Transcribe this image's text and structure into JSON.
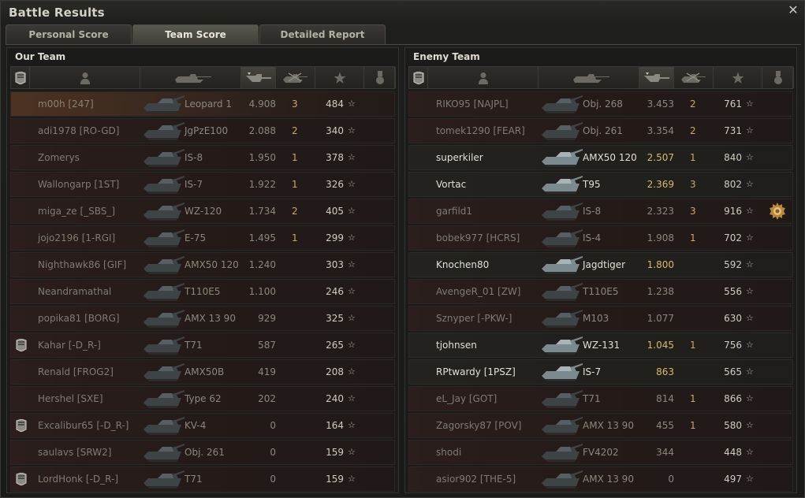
{
  "window": {
    "title": "Battle Results"
  },
  "tabs": [
    {
      "label": "Personal Score",
      "active": false
    },
    {
      "label": "Team Score",
      "active": true
    },
    {
      "label": "Detailed Report",
      "active": false
    }
  ],
  "columns": [
    "badge-icon",
    "player-icon",
    "vehicle-icon",
    "damage-icon",
    "kills-icon",
    "xp-star-icon",
    "medal-icon"
  ],
  "our_team": {
    "title": "Our Team",
    "players": [
      {
        "name": "m00h [247]",
        "vehicle": "Leopard 1",
        "damage": "4.908",
        "kills": "3",
        "xp": "484",
        "badge": false,
        "alive": false,
        "me": true
      },
      {
        "name": "adi1978 [RO-GD]",
        "vehicle": "JgPzE100",
        "damage": "2.088",
        "kills": "2",
        "xp": "340",
        "badge": false,
        "alive": false
      },
      {
        "name": "Zomerys",
        "vehicle": "IS-8",
        "damage": "1.950",
        "kills": "1",
        "xp": "378",
        "badge": false,
        "alive": false
      },
      {
        "name": "Wallongarp [1ST]",
        "vehicle": "IS-7",
        "damage": "1.922",
        "kills": "1",
        "xp": "326",
        "badge": false,
        "alive": false
      },
      {
        "name": "miga_ze [_SBS_]",
        "vehicle": "WZ-120",
        "damage": "1.734",
        "kills": "2",
        "xp": "405",
        "badge": false,
        "alive": false
      },
      {
        "name": "jojo2196 [1-RGI]",
        "vehicle": "E-75",
        "damage": "1.495",
        "kills": "1",
        "xp": "299",
        "badge": false,
        "alive": false
      },
      {
        "name": "Nighthawk86 [GIF]",
        "vehicle": "AMX50 120",
        "damage": "1.240",
        "kills": "",
        "xp": "303",
        "badge": false,
        "alive": false
      },
      {
        "name": "Neandramathal",
        "vehicle": "T110E5",
        "damage": "1.100",
        "kills": "",
        "xp": "246",
        "badge": false,
        "alive": false
      },
      {
        "name": "popika81 [BORG]",
        "vehicle": "AMX 13 90",
        "damage": "929",
        "kills": "",
        "xp": "325",
        "badge": false,
        "alive": false
      },
      {
        "name": "Kahar [-D_R-]",
        "vehicle": "T71",
        "damage": "587",
        "kills": "",
        "xp": "265",
        "badge": true,
        "alive": false
      },
      {
        "name": "Renald [FROG2]",
        "vehicle": "AMX50B",
        "damage": "419",
        "kills": "",
        "xp": "208",
        "badge": false,
        "alive": false
      },
      {
        "name": "Hershel [SXE]",
        "vehicle": "Type 62",
        "damage": "202",
        "kills": "",
        "xp": "240",
        "badge": false,
        "alive": false
      },
      {
        "name": "Excalibur65 [-D_R-]",
        "vehicle": "KV-4",
        "damage": "0",
        "kills": "",
        "xp": "164",
        "badge": true,
        "alive": false
      },
      {
        "name": "saulavs [SRW2]",
        "vehicle": "Obj. 261",
        "damage": "0",
        "kills": "",
        "xp": "159",
        "badge": false,
        "alive": false
      },
      {
        "name": "LordHonk [-D_R-]",
        "vehicle": "T71",
        "damage": "0",
        "kills": "",
        "xp": "159",
        "badge": true,
        "alive": false
      }
    ]
  },
  "enemy_team": {
    "title": "Enemy Team",
    "players": [
      {
        "name": "RIKO95 [NAJPL]",
        "vehicle": "Obj. 268",
        "damage": "3.453",
        "kills": "2",
        "xp": "761",
        "alive": false
      },
      {
        "name": "tomek1290 [FEAR]",
        "vehicle": "Obj. 261",
        "damage": "3.354",
        "kills": "2",
        "xp": "731",
        "alive": false
      },
      {
        "name": "superkiler",
        "vehicle": "AMX50 120",
        "damage": "2.507",
        "kills": "1",
        "xp": "840",
        "alive": true
      },
      {
        "name": "Vortac",
        "vehicle": "T95",
        "damage": "2.369",
        "kills": "3",
        "xp": "802",
        "alive": true
      },
      {
        "name": "garfild1",
        "vehicle": "IS-8",
        "damage": "2.323",
        "kills": "3",
        "xp": "916",
        "alive": false,
        "medal": true
      },
      {
        "name": "bobek977 [HCRS]",
        "vehicle": "IS-4",
        "damage": "1.908",
        "kills": "1",
        "xp": "702",
        "alive": false
      },
      {
        "name": "Knochen80",
        "vehicle": "Jagdtiger",
        "damage": "1.800",
        "kills": "",
        "xp": "592",
        "alive": true
      },
      {
        "name": "AvengeR_01 [ZW]",
        "vehicle": "T110E5",
        "damage": "1.238",
        "kills": "",
        "xp": "556",
        "alive": false
      },
      {
        "name": "Sznyper [-PKW-]",
        "vehicle": "M103",
        "damage": "1.077",
        "kills": "",
        "xp": "630",
        "alive": false
      },
      {
        "name": "tjohnsen",
        "vehicle": "WZ-131",
        "damage": "1.045",
        "kills": "1",
        "xp": "756",
        "alive": true
      },
      {
        "name": "RPtwardy [1PSZ]",
        "vehicle": "IS-7",
        "damage": "863",
        "kills": "",
        "xp": "565",
        "alive": true
      },
      {
        "name": "eL_Jay [GOT]",
        "vehicle": "T71",
        "damage": "814",
        "kills": "1",
        "xp": "866",
        "alive": false
      },
      {
        "name": "Zagorsky87 [POV]",
        "vehicle": "AMX 13 90",
        "damage": "455",
        "kills": "1",
        "xp": "580",
        "alive": false
      },
      {
        "name": "shodi",
        "vehicle": "FV4202",
        "damage": "344",
        "kills": "",
        "xp": "448",
        "alive": false
      },
      {
        "name": "asior902 [THE-5]",
        "vehicle": "AMX 13 90",
        "damage": "0",
        "kills": "",
        "xp": "497",
        "alive": false
      }
    ]
  },
  "colors": {
    "accent": "#c9a86a",
    "dead_row": "#2b1e1c",
    "alive_row": "#23221f",
    "me_row": "#4d3221"
  },
  "star_glyph": "☆"
}
